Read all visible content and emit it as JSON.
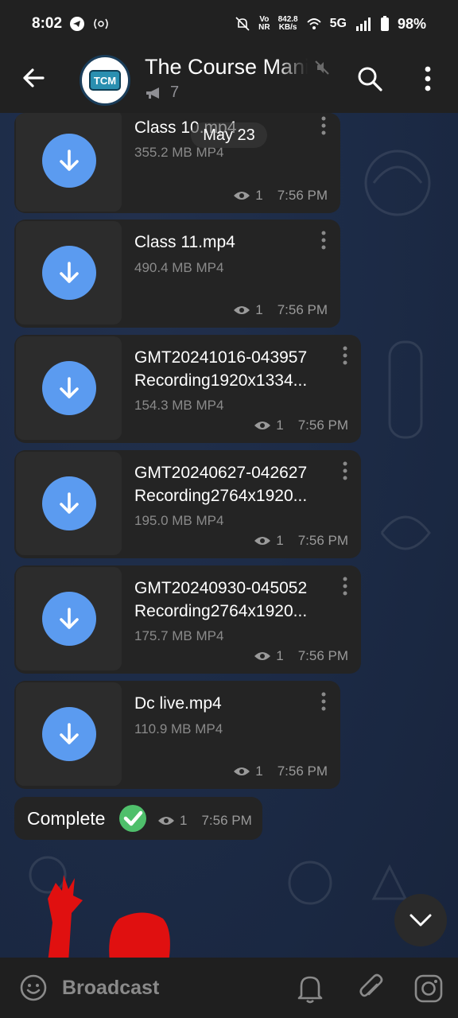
{
  "status_bar": {
    "time": "8:02",
    "network_speed_value": "842.8",
    "network_speed_unit": "KB/s",
    "network_type": "5G",
    "battery": "98%",
    "volte": "Vo",
    "volte_sub": "NR"
  },
  "header": {
    "title": "The Course Mania",
    "avatar_text": "TCM",
    "subscriber_count": "7"
  },
  "date_pill": "May 23",
  "messages": [
    {
      "name_line1": "Class 10.mp4",
      "name_line2": "",
      "meta": "355.2 MB MP4",
      "views": "1",
      "time": "7:56 PM"
    },
    {
      "name_line1": "Class 11.mp4",
      "name_line2": "",
      "meta": "490.4 MB MP4",
      "views": "1",
      "time": "7:56 PM"
    },
    {
      "name_line1": "GMT20241016-043957",
      "name_line2": "Recording1920x1334...",
      "meta": "154.3 MB MP4",
      "views": "1",
      "time": "7:56 PM"
    },
    {
      "name_line1": "GMT20240627-042627",
      "name_line2": "Recording2764x1920...",
      "meta": "195.0 MB MP4",
      "views": "1",
      "time": "7:56 PM"
    },
    {
      "name_line1": "GMT20240930-045052",
      "name_line2": "Recording2764x1920...",
      "meta": "175.7 MB MP4",
      "views": "1",
      "time": "7:56 PM"
    },
    {
      "name_line1": "Dc live.mp4",
      "name_line2": "",
      "meta": "110.9 MB MP4",
      "views": "1",
      "time": "7:56 PM"
    }
  ],
  "complete_message": {
    "text": "Complete",
    "views": "1",
    "time": "7:56 PM"
  },
  "bottom_bar": {
    "label": "Broadcast"
  },
  "colors": {
    "accent": "#5b9bf0",
    "check_green": "#4fbf6b"
  }
}
